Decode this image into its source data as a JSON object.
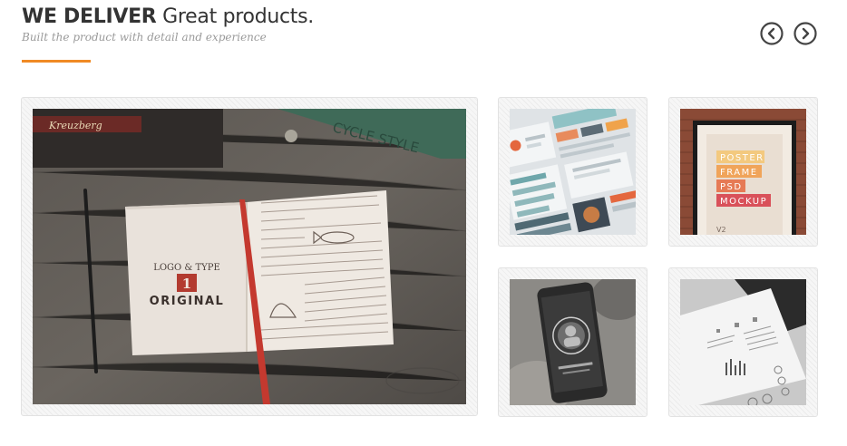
{
  "header": {
    "title_bold": "WE DELIVER",
    "title_light": "Great products.",
    "subtitle": "Built the product with detail and experience"
  },
  "nav": {
    "prev_icon": "chevron-left-circle-icon",
    "next_icon": "chevron-right-circle-icon"
  },
  "colors": {
    "accent": "#f08a24",
    "text": "#333333",
    "muted": "#9a9a9a",
    "frame": "#f4f4f4"
  },
  "portfolio": {
    "featured": {
      "book_title_1": "LOGO & TYPE",
      "book_numeral": "1",
      "book_title_2": "ORIGINAL",
      "pencil_text": "CYCLE STYLE"
    },
    "poster": {
      "lines": [
        "POSTER",
        "FRAME",
        "PSD",
        "MOCKUP"
      ],
      "version": "V2"
    }
  }
}
